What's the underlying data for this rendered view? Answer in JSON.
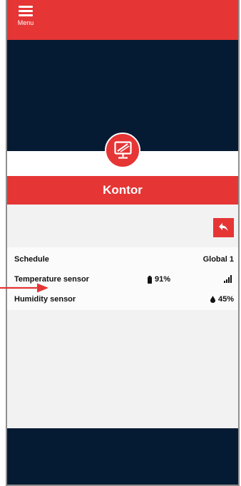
{
  "header": {
    "menu_label": "Menu"
  },
  "room": {
    "name": "Kontor",
    "icon": "monitor-icon"
  },
  "details": {
    "schedule_label": "Schedule",
    "schedule_value": "Global 1",
    "temperature_label": "Temperature sensor",
    "battery_value": "91%",
    "humidity_label": "Humidity sensor",
    "humidity_value": "45%"
  },
  "colors": {
    "accent": "#e53535",
    "dark": "#051b33",
    "panel": "#f2f2f2"
  }
}
